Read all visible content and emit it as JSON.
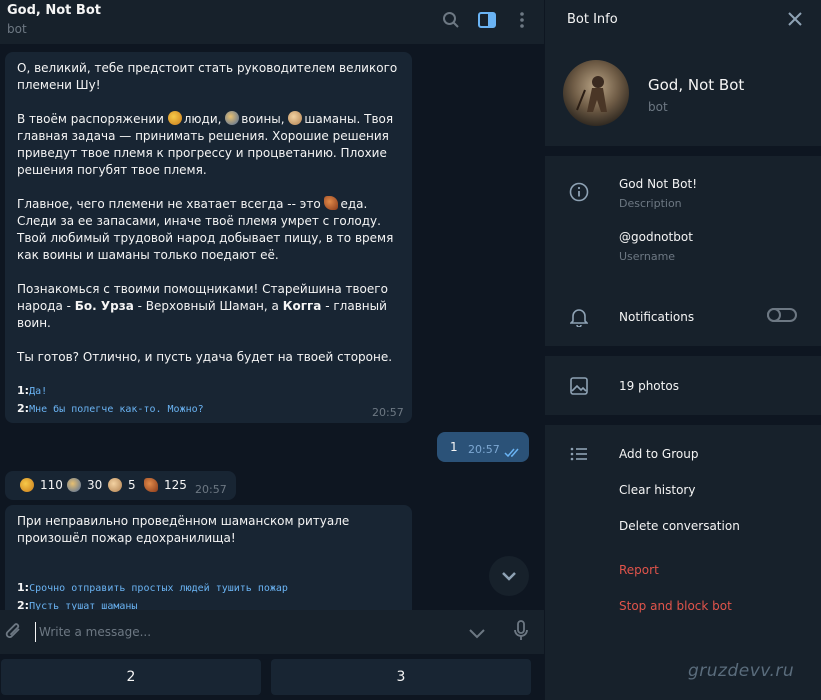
{
  "header": {
    "title": "God, Not Bot",
    "subtitle": "bot"
  },
  "messages": {
    "intro": {
      "line1": "О, великий, тебе предстоит стать руководителем великого племени Шу!",
      "p2_a": "В твоём распоряжении ",
      "p2_people": "люди, ",
      "p2_warriors": "воины, ",
      "p2_shamans": "шаманы. Твоя главная задача — принимать решения. Хорошие решения приведут твое племя к прогрессу и процветанию. Плохие решения погубят твое племя.",
      "p3_a": "Главное, чего племени не хватает всегда -- это ",
      "p3_b": "еда. Следи за ее запасами, иначе твоё племя умрет с голоду. Твой любимый трудовой народ добывает пищу, в то время как воины и шаманы только поедают её.",
      "p4_a": "Познакомься с твоими помощниками! Старейшина твоего народа - ",
      "p4_elder": "Бо. Урза",
      "p4_b": " - Верховный Шаман, а ",
      "p4_warrior": "Когга",
      "p4_c": " - главный воин.",
      "p5": "Ты готов? Отлично, и пусть удача будет на твоей стороне.",
      "opt1_num": "1:",
      "opt1": "Да!",
      "opt2_num": "2:",
      "opt2": "Мне бы полегче как-то. Можно?",
      "time": "20:57"
    },
    "outgoing": {
      "text": "1",
      "time": "20:57"
    },
    "stats": {
      "people": "110",
      "warriors": "30",
      "shamans": "5",
      "food": "125",
      "time": "20:57"
    },
    "fire": {
      "text": "При неправильно проведённом шаманском ритуале произошёл пожар едохранилища!",
      "opt1_num": "1:",
      "opt1": "Срочно отправить простых людей тушить пожар",
      "opt2_num": "2:",
      "opt2": "Пусть тушат шаманы"
    }
  },
  "composer": {
    "placeholder": "Write a message..."
  },
  "keyboard": {
    "btn1": "2",
    "btn2": "3"
  },
  "info": {
    "title": "Bot Info",
    "name": "God, Not Bot",
    "type": "bot",
    "description": "God Not Bot!",
    "description_label": "Description",
    "username": "@godnotbot",
    "username_label": "Username",
    "notifications": "Notifications",
    "photos": "19 photos",
    "add_to_group": "Add to Group",
    "clear_history": "Clear history",
    "delete_conversation": "Delete conversation",
    "report": "Report",
    "stop_block": "Stop and block bot"
  },
  "watermark": "gruzdevv.ru",
  "colors": {
    "bg": "#0e1621",
    "panel": "#17212b",
    "bubble_in": "#182533",
    "bubble_out": "#2b5278",
    "accent": "#6ab3f3",
    "danger": "#e0544b"
  }
}
